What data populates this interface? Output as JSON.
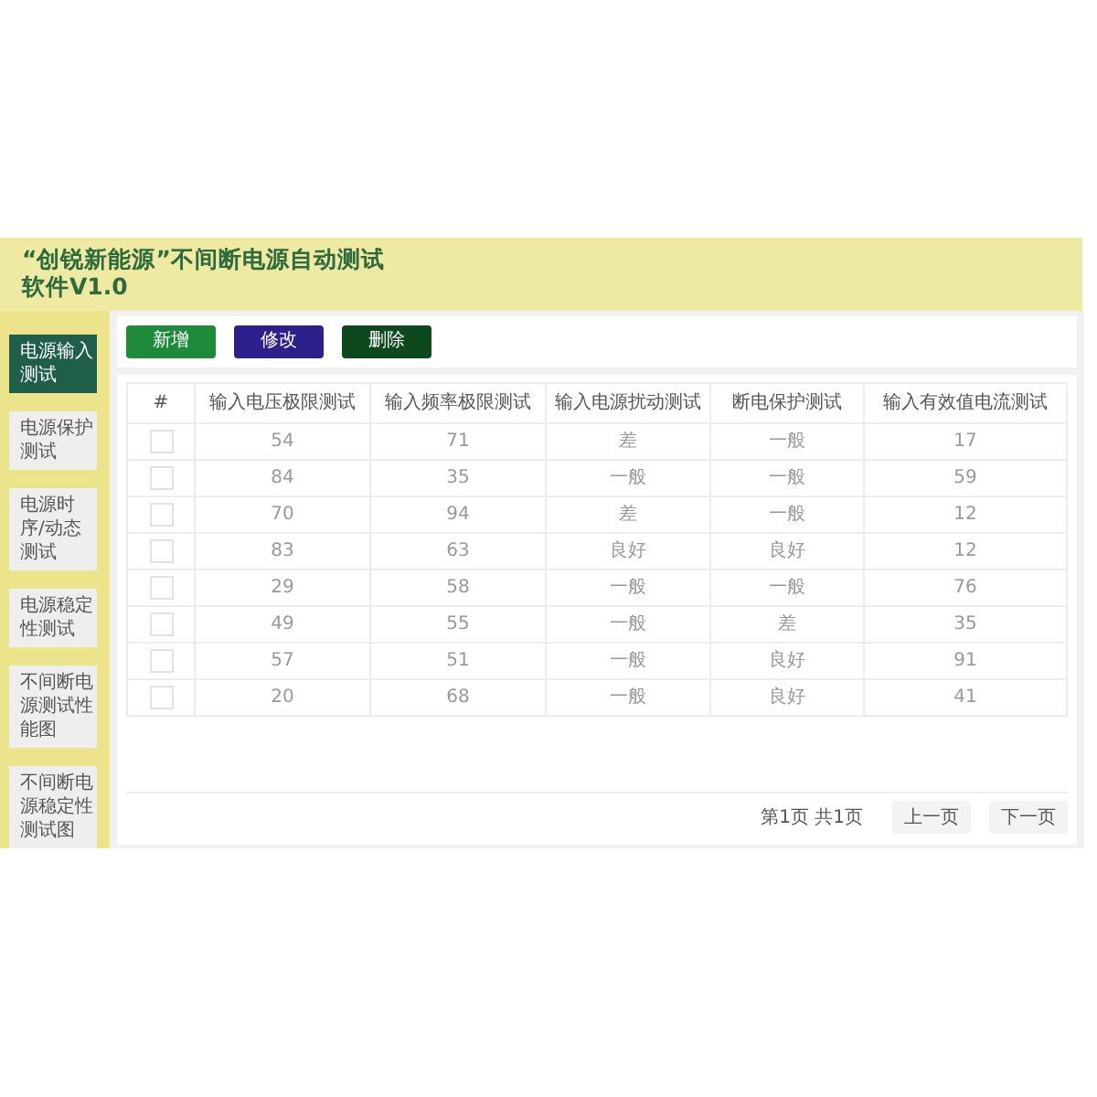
{
  "header": {
    "title": "“创锐新能源”不间断电源自动测试软件V1.0"
  },
  "sidebar": {
    "items": [
      {
        "label": "电源输入测试",
        "selected": true
      },
      {
        "label": "电源保护测试",
        "selected": false
      },
      {
        "label": "电源时序/动态测试",
        "selected": false
      },
      {
        "label": "电源稳定性测试",
        "selected": false
      },
      {
        "label": "不间断电源测试性能图",
        "selected": false
      },
      {
        "label": "不间断电源稳定性测试图",
        "selected": false
      }
    ]
  },
  "toolbar": {
    "buttons": [
      {
        "label": "新增",
        "kind": "add"
      },
      {
        "label": "修改",
        "kind": "edit"
      },
      {
        "label": "删除",
        "kind": "delete"
      }
    ]
  },
  "table": {
    "columns": [
      "#",
      "输入电压极限测试",
      "输入频率极限测试",
      "输入电源扰动测试",
      "断电保护测试",
      "输入有效值电流测试"
    ],
    "rows": [
      {
        "cells": [
          {
            "checked": false
          },
          "54",
          "71",
          "差",
          "一般",
          "17"
        ]
      },
      {
        "cells": [
          {
            "checked": false
          },
          "84",
          "35",
          "一般",
          "一般",
          "59"
        ]
      },
      {
        "cells": [
          {
            "checked": false
          },
          "70",
          "94",
          "差",
          "一般",
          "12"
        ]
      },
      {
        "cells": [
          {
            "checked": false
          },
          "83",
          "63",
          "良好",
          "良好",
          "12"
        ]
      },
      {
        "cells": [
          {
            "checked": false
          },
          "29",
          "58",
          "一般",
          "一般",
          "76"
        ]
      },
      {
        "cells": [
          {
            "checked": false
          },
          "49",
          "55",
          "一般",
          "差",
          "35"
        ]
      },
      {
        "cells": [
          {
            "checked": false
          },
          "57",
          "51",
          "一般",
          "良好",
          "91"
        ]
      },
      {
        "cells": [
          {
            "checked": false
          },
          "20",
          "68",
          "一般",
          "良好",
          "41"
        ]
      }
    ]
  },
  "pagination": {
    "info": "第1页 共1页",
    "buttons": [
      "上一页",
      "下一页"
    ]
  }
}
